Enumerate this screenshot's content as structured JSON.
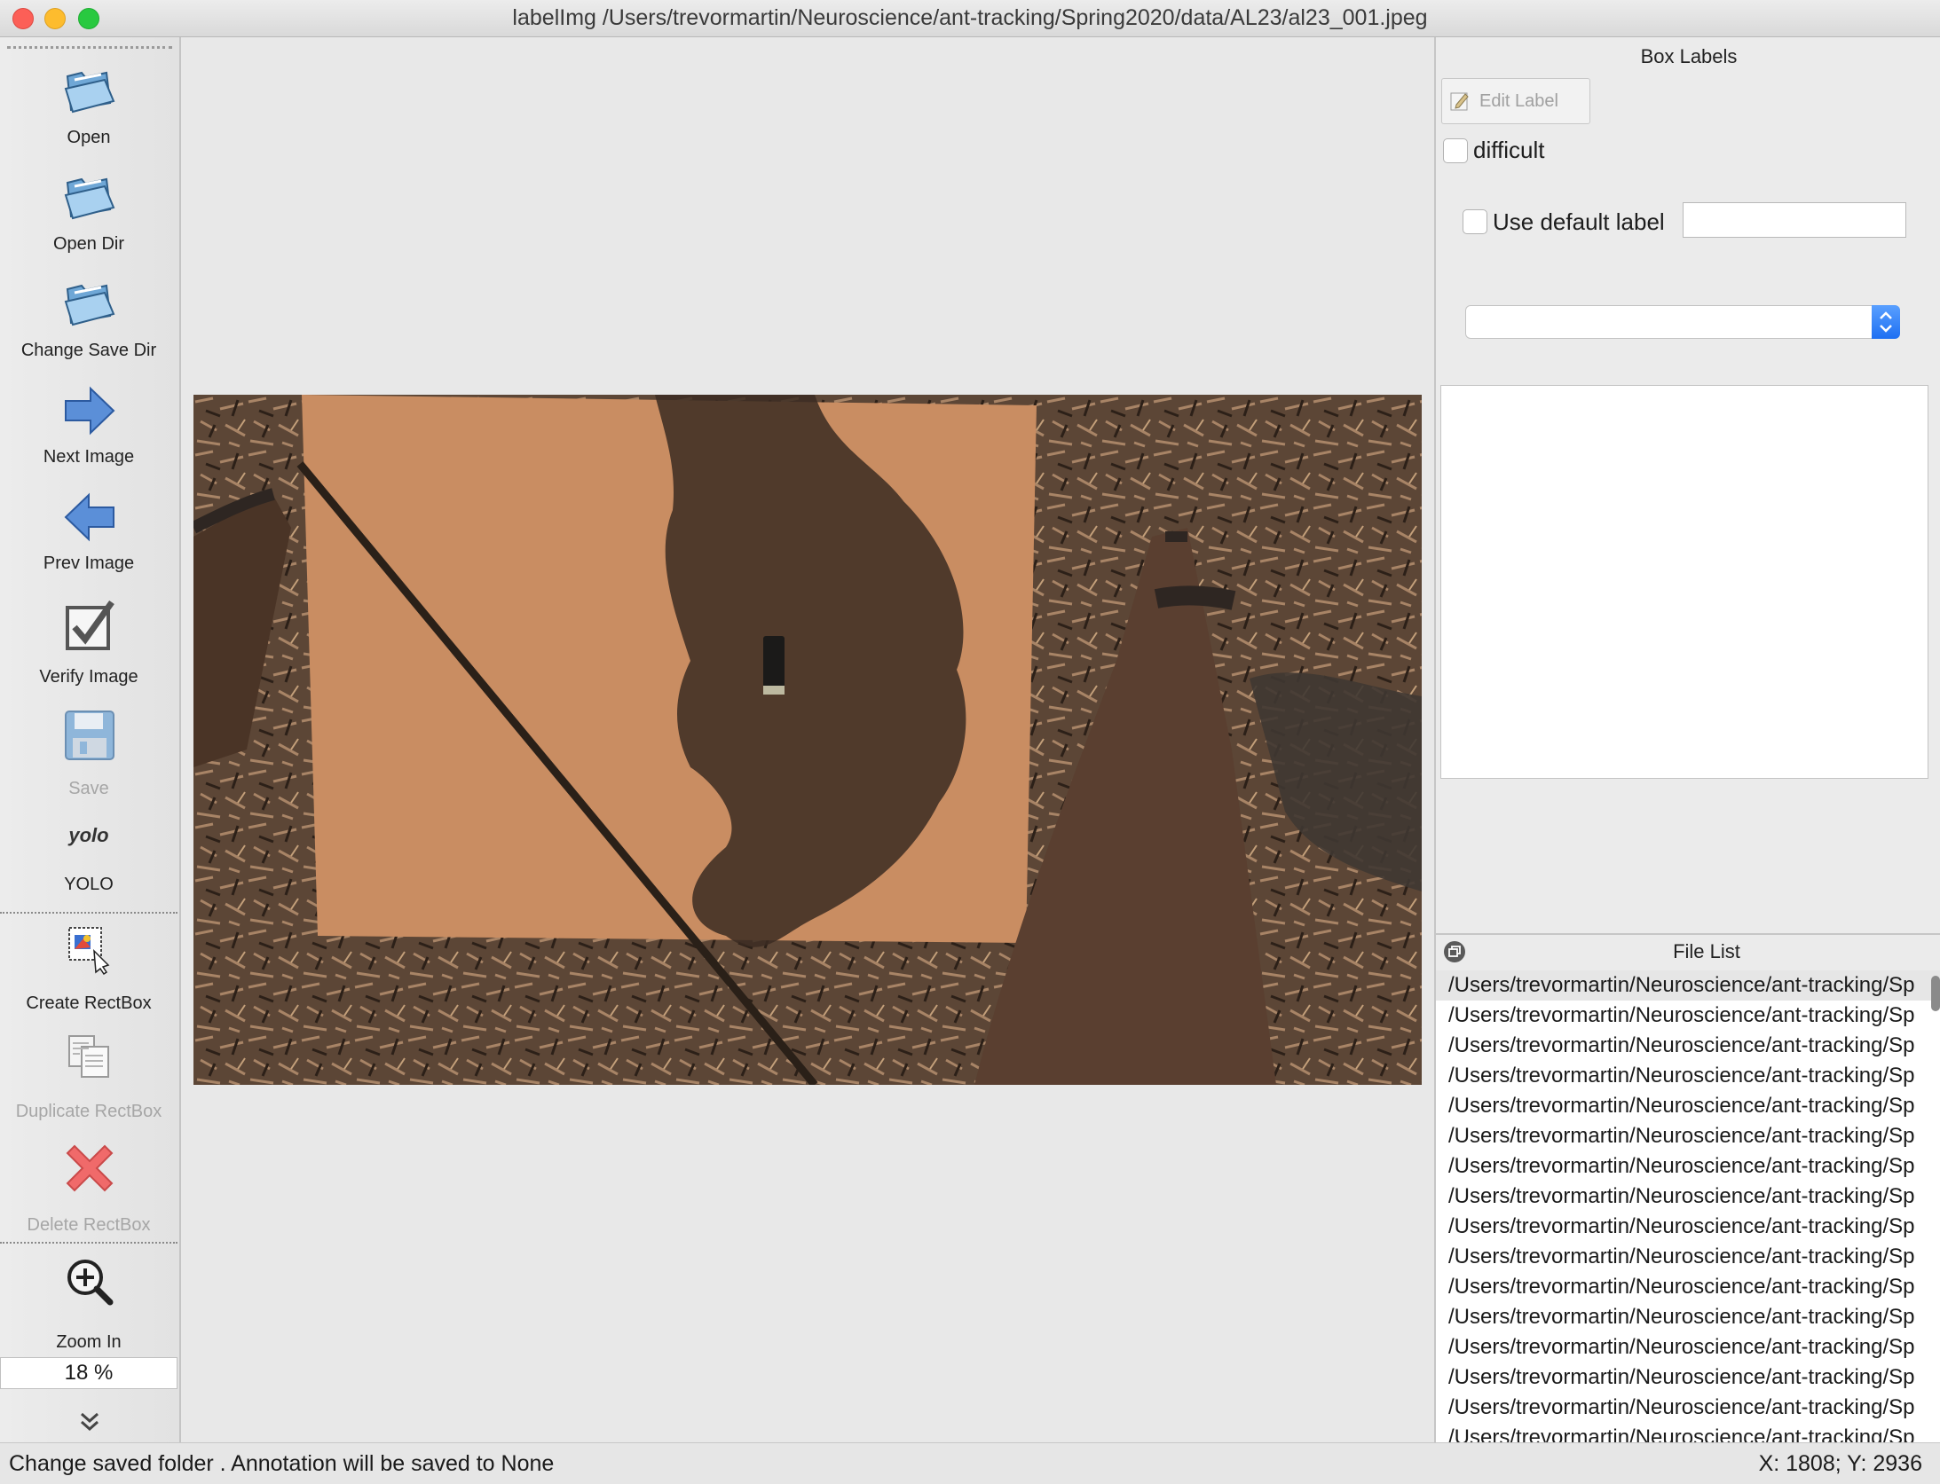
{
  "window": {
    "title": "labelImg /Users/trevormartin/Neuroscience/ant-tracking/Spring2020/data/AL23/al23_001.jpeg"
  },
  "toolbar": {
    "open": "Open",
    "open_dir": "Open Dir",
    "change_save_dir": "Change Save Dir",
    "next_image": "Next Image",
    "prev_image": "Prev Image",
    "verify_image": "Verify Image",
    "save": "Save",
    "yolo_icon_text": "yolo",
    "yolo": "YOLO",
    "create_rectbox": "Create RectBox",
    "duplicate_rectbox": "Duplicate RectBox",
    "delete_rectbox": "Delete RectBox",
    "zoom_in": "Zoom In",
    "zoom_value": "18 %"
  },
  "box_labels": {
    "title": "Box Labels",
    "edit_label": "Edit Label",
    "difficult": "difficult",
    "use_default_label": "Use default label",
    "default_label_value": "",
    "combo_value": ""
  },
  "file_list": {
    "title": "File List",
    "items": [
      "/Users/trevormartin/Neuroscience/ant-tracking/Sp",
      "/Users/trevormartin/Neuroscience/ant-tracking/Sp",
      "/Users/trevormartin/Neuroscience/ant-tracking/Sp",
      "/Users/trevormartin/Neuroscience/ant-tracking/Sp",
      "/Users/trevormartin/Neuroscience/ant-tracking/Sp",
      "/Users/trevormartin/Neuroscience/ant-tracking/Sp",
      "/Users/trevormartin/Neuroscience/ant-tracking/Sp",
      "/Users/trevormartin/Neuroscience/ant-tracking/Sp",
      "/Users/trevormartin/Neuroscience/ant-tracking/Sp",
      "/Users/trevormartin/Neuroscience/ant-tracking/Sp",
      "/Users/trevormartin/Neuroscience/ant-tracking/Sp",
      "/Users/trevormartin/Neuroscience/ant-tracking/Sp",
      "/Users/trevormartin/Neuroscience/ant-tracking/Sp",
      "/Users/trevormartin/Neuroscience/ant-tracking/Sp",
      "/Users/trevormartin/Neuroscience/ant-tracking/Sp",
      "/Users/trevormartin/Neuroscience/ant-tracking/Sp"
    ]
  },
  "status": {
    "message": "Change saved folder . Annotation will be saved to None",
    "coords": "X: 1808; Y: 2936"
  },
  "colors": {
    "accent": "#1d6ff2",
    "cardboard": "#c98d62",
    "ground": "#5a4534"
  }
}
